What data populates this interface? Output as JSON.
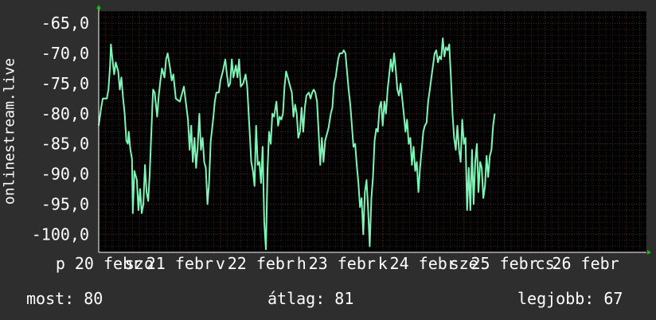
{
  "chart_data": {
    "type": "line",
    "ylabel": "onlinestream.live",
    "ylim": [
      -103,
      -63
    ],
    "yticks": [
      -100,
      -95,
      -90,
      -85,
      -80,
      -75,
      -70,
      -65
    ],
    "ytick_labels": [
      "-100,0",
      "-95,0",
      "-90,0",
      "-85,0",
      "-80,0",
      "-75,0",
      "-70,0",
      "-65,0"
    ],
    "xlim": [
      0,
      6.75
    ],
    "x_tick_labels": [
      {
        "x": 0.0,
        "label": "p 20 febr"
      },
      {
        "x": 0.5,
        "label": "szo"
      },
      {
        "x": 1.0,
        "label": "21 febr"
      },
      {
        "x": 1.5,
        "label": "v"
      },
      {
        "x": 2.0,
        "label": "22 febr"
      },
      {
        "x": 2.5,
        "label": "h"
      },
      {
        "x": 3.0,
        "label": "23 febr"
      },
      {
        "x": 3.5,
        "label": "k"
      },
      {
        "x": 4.0,
        "label": "24 febr"
      },
      {
        "x": 4.5,
        "label": "sze"
      },
      {
        "x": 5.0,
        "label": "25 febr"
      },
      {
        "x": 5.5,
        "label": "cs"
      },
      {
        "x": 6.0,
        "label": "26 febr"
      }
    ],
    "grid": true,
    "colors": {
      "background": "#2e2e2e",
      "plot": "#000000",
      "line": "#7df5b5",
      "grid_major": "#5a2a2a",
      "grid_minor": "#3a2424",
      "arrow": "#00cc00",
      "text": "#ffffff"
    },
    "series": [
      {
        "values": [
          [
            0.0,
            -82
          ],
          [
            0.03,
            -79
          ],
          [
            0.05,
            -77.5
          ],
          [
            0.1,
            -77.5
          ],
          [
            0.12,
            -76
          ],
          [
            0.14,
            -72
          ],
          [
            0.15,
            -68.5
          ],
          [
            0.17,
            -71
          ],
          [
            0.19,
            -73.5
          ],
          [
            0.21,
            -71.5
          ],
          [
            0.24,
            -73
          ],
          [
            0.26,
            -76
          ],
          [
            0.28,
            -74
          ],
          [
            0.3,
            -77.5
          ],
          [
            0.32,
            -80
          ],
          [
            0.34,
            -84.5
          ],
          [
            0.36,
            -85
          ],
          [
            0.37,
            -83
          ],
          [
            0.39,
            -86
          ],
          [
            0.41,
            -87.5
          ],
          [
            0.42,
            -96.5
          ],
          [
            0.44,
            -89.5
          ],
          [
            0.47,
            -91
          ],
          [
            0.49,
            -96
          ],
          [
            0.51,
            -92.5
          ],
          [
            0.53,
            -96.5
          ],
          [
            0.55,
            -95
          ],
          [
            0.57,
            -88.5
          ],
          [
            0.59,
            -93
          ],
          [
            0.61,
            -94.5
          ],
          [
            0.63,
            -89.5
          ],
          [
            0.66,
            -79
          ],
          [
            0.67,
            -76
          ],
          [
            0.69,
            -76.5
          ],
          [
            0.72,
            -80.5
          ],
          [
            0.74,
            -77
          ],
          [
            0.76,
            -74.5
          ],
          [
            0.78,
            -72.5
          ],
          [
            0.81,
            -74
          ],
          [
            0.83,
            -71
          ],
          [
            0.85,
            -70
          ],
          [
            0.88,
            -72.5
          ],
          [
            0.9,
            -74.5
          ],
          [
            0.92,
            -73.5
          ],
          [
            0.95,
            -77.5
          ],
          [
            1.0,
            -78
          ],
          [
            1.05,
            -75.5
          ],
          [
            1.1,
            -81
          ],
          [
            1.12,
            -86
          ],
          [
            1.14,
            -82
          ],
          [
            1.16,
            -88
          ],
          [
            1.18,
            -84
          ],
          [
            1.2,
            -89
          ],
          [
            1.22,
            -85.5
          ],
          [
            1.24,
            -80
          ],
          [
            1.26,
            -86
          ],
          [
            1.28,
            -84
          ],
          [
            1.3,
            -88
          ],
          [
            1.32,
            -89
          ],
          [
            1.34,
            -95
          ],
          [
            1.36,
            -91.5
          ],
          [
            1.38,
            -84.5
          ],
          [
            1.41,
            -81
          ],
          [
            1.43,
            -78
          ],
          [
            1.45,
            -76.5
          ],
          [
            1.48,
            -76.5
          ],
          [
            1.5,
            -74.5
          ],
          [
            1.53,
            -73
          ],
          [
            1.56,
            -71
          ],
          [
            1.58,
            -73.5
          ],
          [
            1.6,
            -75.5
          ],
          [
            1.62,
            -75
          ],
          [
            1.64,
            -71
          ],
          [
            1.66,
            -74
          ],
          [
            1.69,
            -72
          ],
          [
            1.71,
            -74
          ],
          [
            1.73,
            -71
          ],
          [
            1.75,
            -75.5
          ],
          [
            1.78,
            -75
          ],
          [
            1.81,
            -73.5
          ],
          [
            1.83,
            -75.5
          ],
          [
            1.86,
            -83
          ],
          [
            1.88,
            -88
          ],
          [
            1.9,
            -89.5
          ],
          [
            1.92,
            -92
          ],
          [
            1.94,
            -82
          ],
          [
            1.96,
            -88.5
          ],
          [
            1.98,
            -88
          ],
          [
            2.0,
            -91.5
          ],
          [
            2.02,
            -85.5
          ],
          [
            2.04,
            -98
          ],
          [
            2.06,
            -102.5
          ],
          [
            2.08,
            -89.5
          ],
          [
            2.1,
            -83
          ],
          [
            2.12,
            -85
          ],
          [
            2.14,
            -80
          ],
          [
            2.16,
            -80.5
          ],
          [
            2.19,
            -78
          ],
          [
            2.21,
            -82
          ],
          [
            2.23,
            -80.5
          ],
          [
            2.25,
            -81
          ],
          [
            2.27,
            -80
          ],
          [
            2.29,
            -75.5
          ],
          [
            2.31,
            -73
          ],
          [
            2.33,
            -74
          ],
          [
            2.36,
            -75.5
          ],
          [
            2.38,
            -76.5
          ],
          [
            2.4,
            -80.5
          ],
          [
            2.42,
            -78.5
          ],
          [
            2.44,
            -80
          ],
          [
            2.46,
            -84
          ],
          [
            2.48,
            -83
          ],
          [
            2.5,
            -79
          ],
          [
            2.52,
            -83
          ],
          [
            2.54,
            -79
          ],
          [
            2.56,
            -77
          ],
          [
            2.59,
            -76.5
          ],
          [
            2.61,
            -77.5
          ],
          [
            2.63,
            -76.5
          ],
          [
            2.65,
            -76
          ],
          [
            2.67,
            -76.5
          ],
          [
            2.69,
            -78
          ],
          [
            2.71,
            -83
          ],
          [
            2.73,
            -88.5
          ],
          [
            2.75,
            -84
          ],
          [
            2.77,
            -88
          ],
          [
            2.79,
            -84.5
          ],
          [
            2.81,
            -83.5
          ],
          [
            2.83,
            -82.5
          ],
          [
            2.86,
            -80
          ],
          [
            2.88,
            -79
          ],
          [
            2.9,
            -75
          ],
          [
            2.92,
            -74
          ],
          [
            2.95,
            -71
          ],
          [
            2.97,
            -70
          ],
          [
            3.0,
            -70
          ],
          [
            3.02,
            -69.5
          ],
          [
            3.04,
            -70
          ],
          [
            3.06,
            -73
          ],
          [
            3.08,
            -76
          ],
          [
            3.1,
            -78.5
          ],
          [
            3.12,
            -82
          ],
          [
            3.14,
            -85.5
          ],
          [
            3.16,
            -85
          ],
          [
            3.18,
            -88.5
          ],
          [
            3.2,
            -91.5
          ],
          [
            3.22,
            -95.5
          ],
          [
            3.24,
            -94
          ],
          [
            3.26,
            -100
          ],
          [
            3.28,
            -93
          ],
          [
            3.3,
            -91
          ],
          [
            3.32,
            -96
          ],
          [
            3.34,
            -102
          ],
          [
            3.36,
            -94
          ],
          [
            3.38,
            -90.5
          ],
          [
            3.4,
            -84.5
          ],
          [
            3.42,
            -82.5
          ],
          [
            3.44,
            -83
          ],
          [
            3.46,
            -79
          ],
          [
            3.48,
            -78
          ],
          [
            3.5,
            -82
          ],
          [
            3.52,
            -78
          ],
          [
            3.54,
            -80
          ],
          [
            3.56,
            -76
          ],
          [
            3.58,
            -73.5
          ],
          [
            3.6,
            -71
          ],
          [
            3.62,
            -73
          ],
          [
            3.64,
            -70
          ],
          [
            3.66,
            -72.5
          ],
          [
            3.68,
            -76
          ],
          [
            3.7,
            -77
          ],
          [
            3.72,
            -75
          ],
          [
            3.74,
            -77.5
          ],
          [
            3.76,
            -80
          ],
          [
            3.78,
            -83
          ],
          [
            3.8,
            -81
          ],
          [
            3.82,
            -85
          ],
          [
            3.84,
            -84
          ],
          [
            3.86,
            -88.5
          ],
          [
            3.88,
            -85.5
          ],
          [
            3.9,
            -89.5
          ],
          [
            3.92,
            -88
          ],
          [
            3.94,
            -93
          ],
          [
            3.96,
            -89
          ],
          [
            3.98,
            -86
          ],
          [
            4.0,
            -83
          ],
          [
            4.02,
            -82
          ],
          [
            4.04,
            -81.5
          ],
          [
            4.06,
            -78
          ],
          [
            4.08,
            -76
          ],
          [
            4.1,
            -74
          ],
          [
            4.12,
            -72
          ],
          [
            4.14,
            -70
          ],
          [
            4.16,
            -69.5
          ],
          [
            4.18,
            -71.5
          ],
          [
            4.2,
            -70.5
          ],
          [
            4.22,
            -71
          ],
          [
            4.24,
            -67.5
          ],
          [
            4.26,
            -70.5
          ],
          [
            4.28,
            -69
          ],
          [
            4.3,
            -69.5
          ],
          [
            4.32,
            -68.5
          ],
          [
            4.34,
            -74
          ],
          [
            4.36,
            -80
          ],
          [
            4.38,
            -84
          ],
          [
            4.4,
            -86
          ],
          [
            4.42,
            -82
          ],
          [
            4.44,
            -86
          ],
          [
            4.46,
            -88
          ],
          [
            4.48,
            -81
          ],
          [
            4.5,
            -85
          ],
          [
            4.52,
            -84
          ],
          [
            4.54,
            -96
          ],
          [
            4.56,
            -89
          ],
          [
            4.58,
            -96
          ],
          [
            4.6,
            -86
          ],
          [
            4.62,
            -95
          ],
          [
            4.64,
            -88
          ],
          [
            4.66,
            -85
          ],
          [
            4.68,
            -93
          ],
          [
            4.7,
            -88
          ],
          [
            4.72,
            -89
          ],
          [
            4.74,
            -94
          ],
          [
            4.76,
            -92
          ],
          [
            4.78,
            -87
          ],
          [
            4.8,
            -90.5
          ],
          [
            4.82,
            -87
          ],
          [
            4.84,
            -86
          ],
          [
            4.86,
            -82
          ],
          [
            4.88,
            -80
          ]
        ]
      }
    ]
  },
  "stats": {
    "now_label": "most:",
    "now_value": "80",
    "avg_label": "átlag:",
    "avg_value": "81",
    "max_label": "legjobb:",
    "max_value": "67"
  }
}
